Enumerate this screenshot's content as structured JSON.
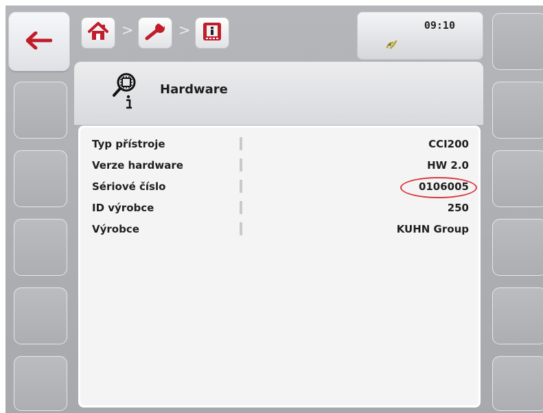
{
  "status": {
    "time": "09:10",
    "icon": "signal-wave-icon"
  },
  "breadcrumb": {
    "items": [
      {
        "icon": "home-icon"
      },
      {
        "icon": "wrench-icon"
      },
      {
        "icon": "info-icon"
      }
    ],
    "separator": ">"
  },
  "back_button": {
    "icon": "arrow-left-icon"
  },
  "header": {
    "title": "Hardware",
    "icon": "chip-magnifier-info-icon"
  },
  "table": {
    "rows": [
      {
        "label": "Typ přístroje",
        "value": "CCI200"
      },
      {
        "label": "Verze hardware",
        "value": "HW 2.0"
      },
      {
        "label": "Sériové číslo",
        "value": "0106005"
      },
      {
        "label": "ID výrobce",
        "value": "250"
      },
      {
        "label": "Výrobce",
        "value": "KUHN Group"
      }
    ]
  },
  "colors": {
    "accent_icon": "#c01d2a",
    "highlight_ring": "#d9363e"
  }
}
